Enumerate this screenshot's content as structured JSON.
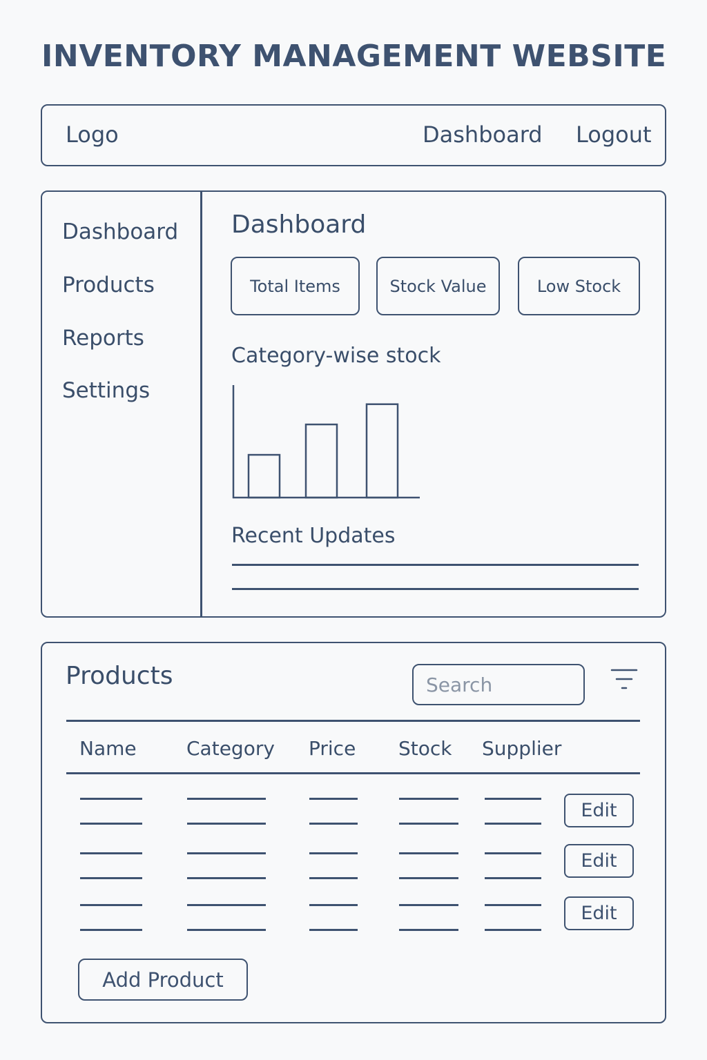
{
  "page_title": "INVENTORY MANAGEMENT WEBSITE",
  "navbar": {
    "logo": "Logo",
    "links": [
      "Dashboard",
      "Logout"
    ]
  },
  "sidebar": {
    "items": [
      "Dashboard",
      "Products",
      "Reports",
      "Settings"
    ]
  },
  "dashboard": {
    "title": "Dashboard",
    "stat_cards": [
      "Total Items",
      "Stock Value",
      "Low Stock"
    ],
    "chart_title": "Category-wise stock",
    "recent_title": "Recent Updates"
  },
  "chart_data": {
    "type": "bar",
    "categories": [
      "",
      "",
      ""
    ],
    "values": [
      38,
      65,
      83
    ],
    "title": "Category-wise stock",
    "ylim": [
      0,
      100
    ],
    "grid": false
  },
  "products": {
    "title": "Products",
    "search_placeholder": "Search",
    "columns": [
      "Name",
      "Category",
      "Price",
      "Stock",
      "Supplier"
    ],
    "rows": [
      {
        "action": "Edit"
      },
      {
        "action": "Edit"
      },
      {
        "action": "Edit"
      }
    ],
    "add_label": "Add Product"
  },
  "colors": {
    "ink": "#3e5270",
    "background": "#f8f9fa",
    "placeholder": "#8a95a5"
  },
  "icons": {
    "filter": "filter-icon"
  }
}
